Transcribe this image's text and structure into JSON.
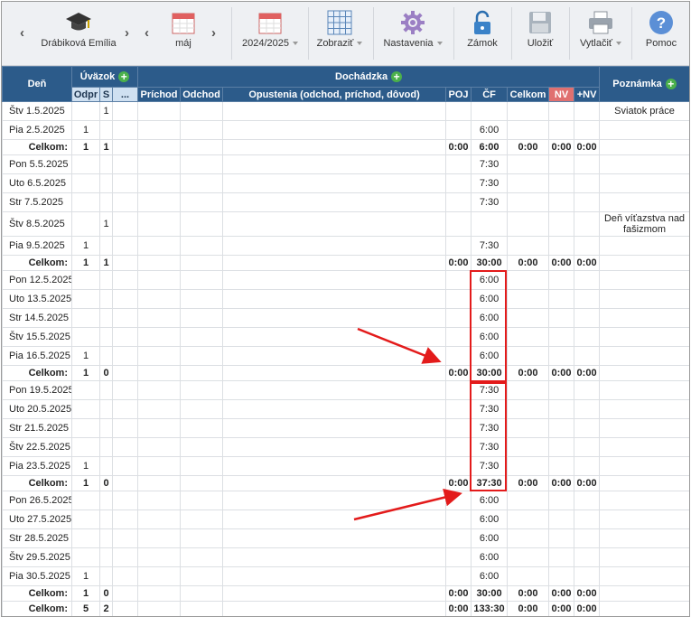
{
  "toolbar": {
    "employee": "Drábiková Emília",
    "month": "máj",
    "year": "2024/2025",
    "zobrazit": "Zobraziť",
    "nastavenia": "Nastavenia",
    "zamok": "Zámok",
    "ulozit": "Uložiť",
    "vytlacit": "Vytlačiť",
    "pomoc": "Pomoc"
  },
  "header": {
    "den": "Deň",
    "uvazok": "Úväzok",
    "dochadzka": "Dochádzka",
    "poznamka": "Poznámka",
    "odpr": "Odpr",
    "s": "S",
    "dots": "...",
    "prichod": "Príchod",
    "odchod": "Odchod",
    "opustenia": "Opustenia (odchod, príchod, dôvod)",
    "poj": "POJ",
    "cf": "ČF",
    "celkom": "Celkom",
    "nv": "NV",
    "plusnv": "+NV"
  },
  "rows": [
    {
      "day": "Štv 1.5.2025",
      "odpr": "",
      "s": "1",
      "poj": "",
      "cf": "",
      "celkom": "",
      "nv": "",
      "pnv": "",
      "note": "Sviatok práce"
    },
    {
      "day": "Pia 2.5.2025",
      "odpr": "1",
      "s": "",
      "poj": "",
      "cf": "6:00",
      "celkom": "",
      "nv": "",
      "pnv": "",
      "note": ""
    },
    {
      "sum": true,
      "day": "Celkom:",
      "odpr": "1",
      "s": "1",
      "poj": "0:00",
      "cf": "6:00",
      "celkom": "0:00",
      "nv": "0:00",
      "pnv": "0:00",
      "note": ""
    },
    {
      "day": "Pon 5.5.2025",
      "odpr": "",
      "s": "",
      "poj": "",
      "cf": "7:30",
      "celkom": "",
      "nv": "",
      "pnv": "",
      "note": ""
    },
    {
      "day": "Uto 6.5.2025",
      "odpr": "",
      "s": "",
      "poj": "",
      "cf": "7:30",
      "celkom": "",
      "nv": "",
      "pnv": "",
      "note": ""
    },
    {
      "day": "Str 7.5.2025",
      "odpr": "",
      "s": "",
      "poj": "",
      "cf": "7:30",
      "celkom": "",
      "nv": "",
      "pnv": "",
      "note": ""
    },
    {
      "day": "Štv 8.5.2025",
      "odpr": "",
      "s": "1",
      "poj": "",
      "cf": "",
      "celkom": "",
      "nv": "",
      "pnv": "",
      "note": "Deň víťazstva nad fašizmom",
      "tall": true
    },
    {
      "day": "Pia 9.5.2025",
      "odpr": "1",
      "s": "",
      "poj": "",
      "cf": "7:30",
      "celkom": "",
      "nv": "",
      "pnv": "",
      "note": ""
    },
    {
      "sum": true,
      "day": "Celkom:",
      "odpr": "1",
      "s": "1",
      "poj": "0:00",
      "cf": "30:00",
      "celkom": "0:00",
      "nv": "0:00",
      "pnv": "0:00",
      "note": ""
    },
    {
      "day": "Pon 12.5.2025",
      "odpr": "",
      "s": "",
      "poj": "",
      "cf": "6:00",
      "celkom": "",
      "nv": "",
      "pnv": "",
      "note": ""
    },
    {
      "day": "Uto 13.5.2025",
      "odpr": "",
      "s": "",
      "poj": "",
      "cf": "6:00",
      "celkom": "",
      "nv": "",
      "pnv": "",
      "note": ""
    },
    {
      "day": "Str 14.5.2025",
      "odpr": "",
      "s": "",
      "poj": "",
      "cf": "6:00",
      "celkom": "",
      "nv": "",
      "pnv": "",
      "note": ""
    },
    {
      "day": "Štv 15.5.2025",
      "odpr": "",
      "s": "",
      "poj": "",
      "cf": "6:00",
      "celkom": "",
      "nv": "",
      "pnv": "",
      "note": ""
    },
    {
      "day": "Pia 16.5.2025",
      "odpr": "1",
      "s": "",
      "poj": "",
      "cf": "6:00",
      "celkom": "",
      "nv": "",
      "pnv": "",
      "note": ""
    },
    {
      "sum": true,
      "day": "Celkom:",
      "odpr": "1",
      "s": "0",
      "poj": "0:00",
      "cf": "30:00",
      "celkom": "0:00",
      "nv": "0:00",
      "pnv": "0:00",
      "note": ""
    },
    {
      "day": "Pon 19.5.2025",
      "odpr": "",
      "s": "",
      "poj": "",
      "cf": "7:30",
      "celkom": "",
      "nv": "",
      "pnv": "",
      "note": ""
    },
    {
      "day": "Uto 20.5.2025",
      "odpr": "",
      "s": "",
      "poj": "",
      "cf": "7:30",
      "celkom": "",
      "nv": "",
      "pnv": "",
      "note": ""
    },
    {
      "day": "Str 21.5.2025",
      "odpr": "",
      "s": "",
      "poj": "",
      "cf": "7:30",
      "celkom": "",
      "nv": "",
      "pnv": "",
      "note": ""
    },
    {
      "day": "Štv 22.5.2025",
      "odpr": "",
      "s": "",
      "poj": "",
      "cf": "7:30",
      "celkom": "",
      "nv": "",
      "pnv": "",
      "note": ""
    },
    {
      "day": "Pia 23.5.2025",
      "odpr": "1",
      "s": "",
      "poj": "",
      "cf": "7:30",
      "celkom": "",
      "nv": "",
      "pnv": "",
      "note": ""
    },
    {
      "sum": true,
      "day": "Celkom:",
      "odpr": "1",
      "s": "0",
      "poj": "0:00",
      "cf": "37:30",
      "celkom": "0:00",
      "nv": "0:00",
      "pnv": "0:00",
      "note": ""
    },
    {
      "day": "Pon 26.5.2025",
      "odpr": "",
      "s": "",
      "poj": "",
      "cf": "6:00",
      "celkom": "",
      "nv": "",
      "pnv": "",
      "note": ""
    },
    {
      "day": "Uto 27.5.2025",
      "odpr": "",
      "s": "",
      "poj": "",
      "cf": "6:00",
      "celkom": "",
      "nv": "",
      "pnv": "",
      "note": ""
    },
    {
      "day": "Str 28.5.2025",
      "odpr": "",
      "s": "",
      "poj": "",
      "cf": "6:00",
      "celkom": "",
      "nv": "",
      "pnv": "",
      "note": ""
    },
    {
      "day": "Štv 29.5.2025",
      "odpr": "",
      "s": "",
      "poj": "",
      "cf": "6:00",
      "celkom": "",
      "nv": "",
      "pnv": "",
      "note": ""
    },
    {
      "day": "Pia 30.5.2025",
      "odpr": "1",
      "s": "",
      "poj": "",
      "cf": "6:00",
      "celkom": "",
      "nv": "",
      "pnv": "",
      "note": ""
    },
    {
      "sum": true,
      "day": "Celkom:",
      "odpr": "1",
      "s": "0",
      "poj": "0:00",
      "cf": "30:00",
      "celkom": "0:00",
      "nv": "0:00",
      "pnv": "0:00",
      "note": ""
    },
    {
      "sum": true,
      "day": "Celkom:",
      "odpr": "5",
      "s": "2",
      "poj": "0:00",
      "cf": "133:30",
      "celkom": "0:00",
      "nv": "0:00",
      "pnv": "0:00",
      "note": ""
    }
  ],
  "colors": {
    "header": "#2c5b8a",
    "subheader": "#cfe0f1",
    "nv": "#e07070",
    "annotation": "#e31b1b"
  }
}
